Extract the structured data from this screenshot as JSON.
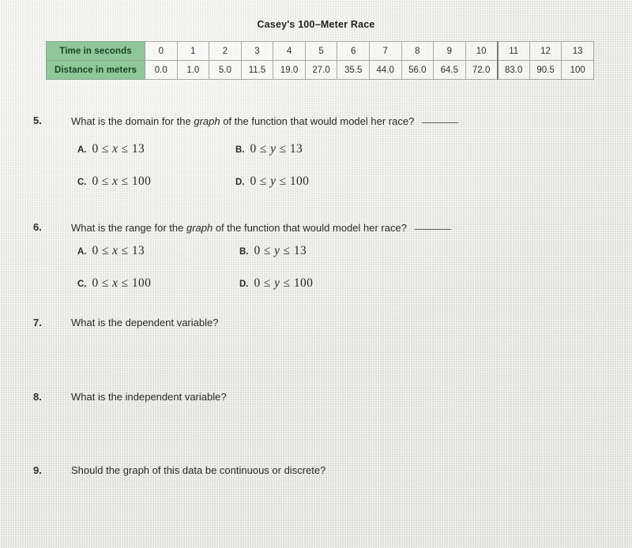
{
  "worksheet": {
    "table": {
      "title": "Casey's 100–Meter Race",
      "row_labels": [
        "Time in seconds",
        "Distance in meters"
      ],
      "time_values": [
        "0",
        "1",
        "2",
        "3",
        "4",
        "5",
        "6",
        "7",
        "8",
        "9",
        "10",
        "11",
        "12",
        "13"
      ],
      "distance_values": [
        "0.0",
        "1.0",
        "5.0",
        "11.5",
        "19.0",
        "27.0",
        "35.5",
        "44.0",
        "56.0",
        "64.5",
        "72.0",
        "83.0",
        "90.5",
        "100"
      ],
      "header_bg_color": "#8fc79a",
      "header_text_color": "#1d4427"
    },
    "questions": [
      {
        "number": "5.",
        "text_before_italic": "What is the domain for the ",
        "italic_word": "graph",
        "text_after_italic": " of the function that would model her race?",
        "has_answer_blank": true,
        "choices": [
          {
            "letter": "A.",
            "math": "0 ≤ x ≤ 13",
            "lhs": "0 ≤ ",
            "var": "x",
            "rhs": " ≤ 13"
          },
          {
            "letter": "B.",
            "math": "0 ≤ y ≤ 13",
            "lhs": "0 ≤ ",
            "var": "y",
            "rhs": " ≤ 13"
          },
          {
            "letter": "C.",
            "math": "0 ≤ x ≤ 100",
            "lhs": "0 ≤ ",
            "var": "x",
            "rhs": " ≤ 100"
          },
          {
            "letter": "D.",
            "math": "0 ≤ y ≤ 100",
            "lhs": "0 ≤ ",
            "var": "y",
            "rhs": " ≤ 100"
          }
        ]
      },
      {
        "number": "6.",
        "text_before_italic": "What is the range for the ",
        "italic_word": "graph",
        "text_after_italic": " of the function that would model her race?",
        "has_answer_blank": true,
        "choices": [
          {
            "letter": "A.",
            "math": "0 ≤ x ≤ 13",
            "lhs": "0 ≤ ",
            "var": "x",
            "rhs": " ≤ 13"
          },
          {
            "letter": "B.",
            "math": "0 ≤ y ≤ 13",
            "lhs": "0 ≤ ",
            "var": "y",
            "rhs": " ≤ 13"
          },
          {
            "letter": "C.",
            "math": "0 ≤ x ≤ 100",
            "lhs": "0 ≤ ",
            "var": "x",
            "rhs": " ≤ 100"
          },
          {
            "letter": "D.",
            "math": "0 ≤ y ≤ 100",
            "lhs": "0 ≤ ",
            "var": "y",
            "rhs": " ≤ 100"
          }
        ]
      },
      {
        "number": "7.",
        "text": "What is the dependent variable?",
        "has_answer_blank": false,
        "choices": []
      },
      {
        "number": "8.",
        "text": "What is the independent variable?",
        "has_answer_blank": false,
        "choices": []
      },
      {
        "number": "9.",
        "text": "Should the graph of this data be continuous or discrete?",
        "has_answer_blank": false,
        "choices": []
      }
    ]
  },
  "chart_data": {
    "type": "table",
    "title": "Casey's 100–Meter Race",
    "xlabel": "Time in seconds",
    "ylabel": "Distance in meters",
    "x": [
      0,
      1,
      2,
      3,
      4,
      5,
      6,
      7,
      8,
      9,
      10,
      11,
      12,
      13
    ],
    "series": [
      {
        "name": "Distance in meters",
        "values": [
          0.0,
          1.0,
          5.0,
          11.5,
          19.0,
          27.0,
          35.5,
          44.0,
          56.0,
          64.5,
          72.0,
          83.0,
          90.5,
          100
        ]
      }
    ],
    "categories": [
      "0",
      "1",
      "2",
      "3",
      "4",
      "5",
      "6",
      "7",
      "8",
      "9",
      "10",
      "11",
      "12",
      "13"
    ],
    "values": [
      0.0,
      1.0,
      5.0,
      11.5,
      19.0,
      27.0,
      35.5,
      44.0,
      56.0,
      64.5,
      72.0,
      83.0,
      90.5,
      100
    ],
    "xlim": [
      0,
      13
    ],
    "ylim": [
      0,
      100
    ],
    "grid": false,
    "legend": "none"
  }
}
